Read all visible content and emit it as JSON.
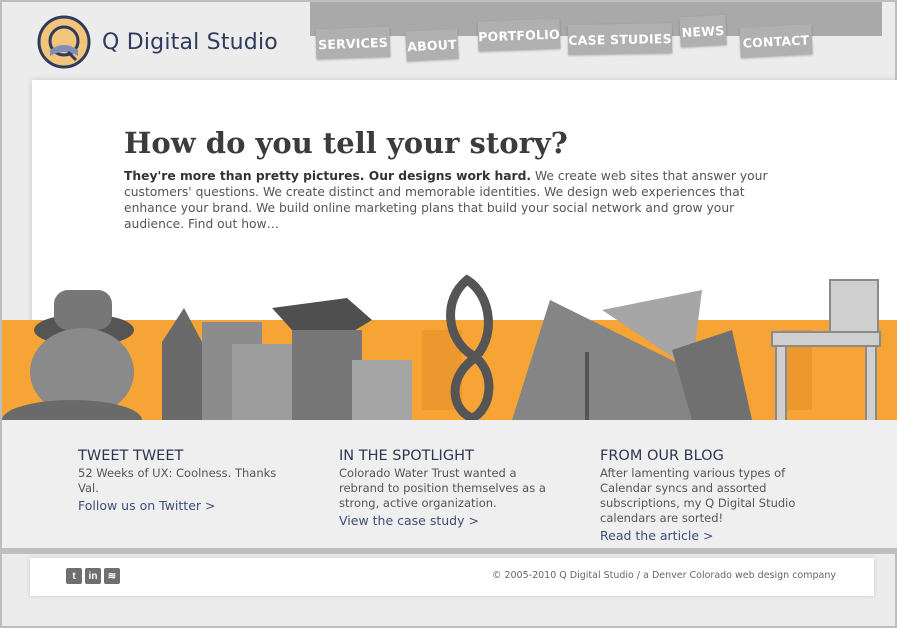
{
  "brand": {
    "name": "Q Digital Studio"
  },
  "nav": {
    "items": [
      "SERVICES",
      "ABOUT",
      "PORTFOLIO",
      "CASE STUDIES",
      "NEWS",
      "CONTACT"
    ]
  },
  "hero": {
    "headline": "How do you tell your story?",
    "intro_bold": "They're more than pretty pictures. Our designs work hard.",
    "intro_rest": " We create web sites that answer your customers' questions. We create distinct and memorable identities. We design web experiences that enhance your brand. We build online marketing plans that build your social network and grow your audience. Find out how…"
  },
  "features": [
    {
      "title": "TWEET TWEET",
      "text": "52 Weeks of UX: Coolness. Thanks Val.",
      "link": "Follow us on Twitter >"
    },
    {
      "title": "IN THE SPOTLIGHT",
      "text": "Colorado Water Trust wanted a rebrand to position themselves as a strong, active organization.",
      "link": "View the case study >"
    },
    {
      "title": "FROM OUR BLOG",
      "text": "After lamenting various types of Calendar syncs and assorted subscriptions, my Q Digital Studio calendars are sorted!",
      "link": "Read the article >"
    }
  ],
  "footer": {
    "social": [
      {
        "icon": "twitter-icon",
        "glyph": "t"
      },
      {
        "icon": "linkedin-icon",
        "glyph": "in"
      },
      {
        "icon": "rss-icon",
        "glyph": "≋"
      }
    ],
    "copyright": "© 2005-2010 Q Digital Studio / a Denver Colorado web design company"
  },
  "colors": {
    "accent": "#f6a435",
    "navy": "#2f3a5c",
    "link": "#3e4d79"
  }
}
